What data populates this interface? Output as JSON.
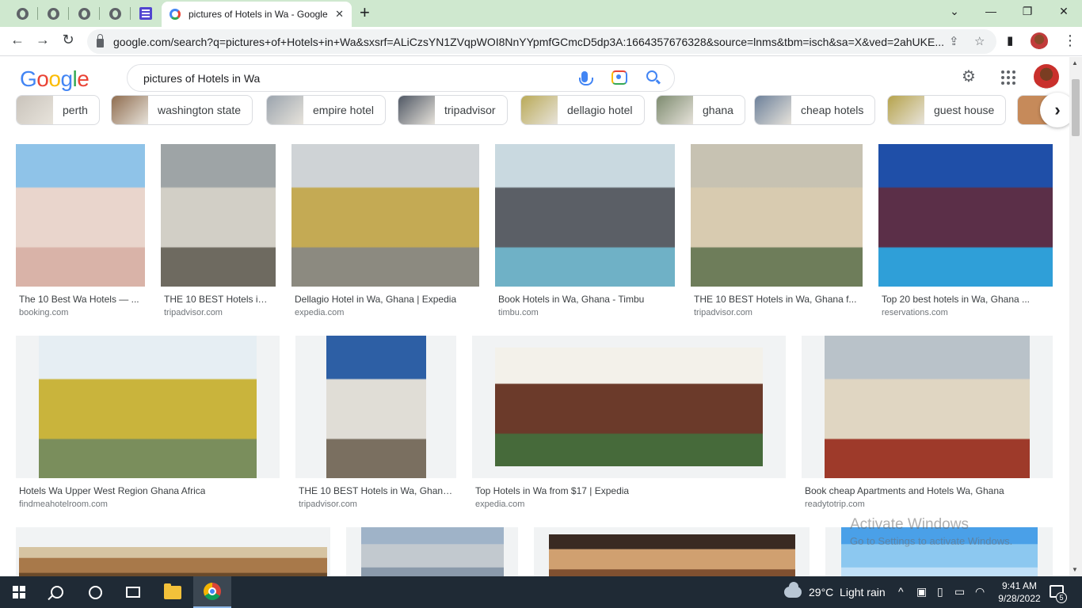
{
  "browser": {
    "active_tab_title": "pictures of Hotels in Wa - Google Search",
    "url": "google.com/search?q=pictures+of+Hotels+in+Wa&sxsrf=ALiCzsYN1ZVqpWOI8NnYYpmfGCmcD5dp3A:1664357676328&source=lnms&tbm=isch&sa=X&ved=2ahUKE..."
  },
  "google": {
    "logo": "Google",
    "query": "pictures of Hotels in Wa"
  },
  "chips": [
    {
      "label": "perth",
      "color": "#c9c3bb"
    },
    {
      "label": "washington state",
      "color": "#8e6b4d"
    },
    {
      "label": "empire hotel",
      "color": "#9aa3ad"
    },
    {
      "label": "tripadvisor",
      "color": "#4e5663"
    },
    {
      "label": "dellagio hotel",
      "color": "#b9a956"
    },
    {
      "label": "ghana",
      "color": "#7c8a6e"
    },
    {
      "label": "cheap hotels",
      "color": "#6b7f99"
    },
    {
      "label": "guest house",
      "color": "#b5a24a"
    }
  ],
  "results": [
    {
      "caption": "The 10 Best Wa Hotels — ...",
      "source": "booking.com",
      "colors": [
        "#8fc3e8",
        "#e9d5cc",
        "#d9b3a8"
      ]
    },
    {
      "caption": "THE 10 BEST Hotels in ...",
      "source": "tripadvisor.com",
      "colors": [
        "#9ea4a6",
        "#d2cfc6",
        "#6e6a60"
      ]
    },
    {
      "caption": "Dellagio Hotel in Wa, Ghana | Expedia",
      "source": "expedia.com",
      "colors": [
        "#cfd3d6",
        "#c4aa54",
        "#8c8a80"
      ]
    },
    {
      "caption": "Book Hotels in Wa, Ghana - Timbu",
      "source": "timbu.com",
      "colors": [
        "#c9d9e0",
        "#5b5f66",
        "#6fb1c6"
      ]
    },
    {
      "caption": "THE 10 BEST Hotels in Wa, Ghana f...",
      "source": "tripadvisor.com",
      "colors": [
        "#c7c2b2",
        "#d8cbb0",
        "#6e7d5a"
      ]
    },
    {
      "caption": "Top 20 best hotels in Wa, Ghana ...",
      "source": "reservations.com",
      "colors": [
        "#1f4fa8",
        "#5b2f48",
        "#2f9fd8"
      ]
    },
    {
      "caption": "Hotels Wa Upper West Region Ghana Africa",
      "source": "findmeahotelroom.com",
      "colors": [
        "#e6eef3",
        "#c9b43c",
        "#7a8e5c"
      ]
    },
    {
      "caption": "THE 10 BEST Hotels in Wa, Ghana...",
      "source": "tripadvisor.com",
      "colors": [
        "#2d5fa5",
        "#e0ddd6",
        "#7a6f60"
      ]
    },
    {
      "caption": "Top Hotels in Wa from $17 | Expedia",
      "source": "expedia.com",
      "colors": [
        "#f3f1ea",
        "#6b3a2a",
        "#466a3a"
      ]
    },
    {
      "caption": "Book cheap Apartments and Hotels Wa, Ghana",
      "source": "readytotrip.com",
      "colors": [
        "#b9c2c9",
        "#e0d6c2",
        "#9e3a2a"
      ]
    },
    {
      "caption": "",
      "source": "",
      "colors": [
        "#d6c4a2",
        "#a8794a",
        "#6a4a2a"
      ]
    },
    {
      "caption": "",
      "source": "",
      "colors": [
        "#9fb3c8",
        "#c2c9cf",
        "#8a9aab"
      ]
    },
    {
      "caption": "",
      "source": "",
      "colors": [
        "#3a2a22",
        "#d0a070",
        "#805030"
      ]
    },
    {
      "caption": "",
      "source": "",
      "colors": [
        "#4aa0e8",
        "#8cc8f0",
        "#c0e0f8"
      ]
    }
  ],
  "watermark": {
    "line1": "Activate Windows",
    "line2": "Go to Settings to activate Windows."
  },
  "taskbar": {
    "weather": "29°C  Light rain",
    "time": "9:41 AM",
    "date": "9/28/2022",
    "notification_count": "5"
  }
}
